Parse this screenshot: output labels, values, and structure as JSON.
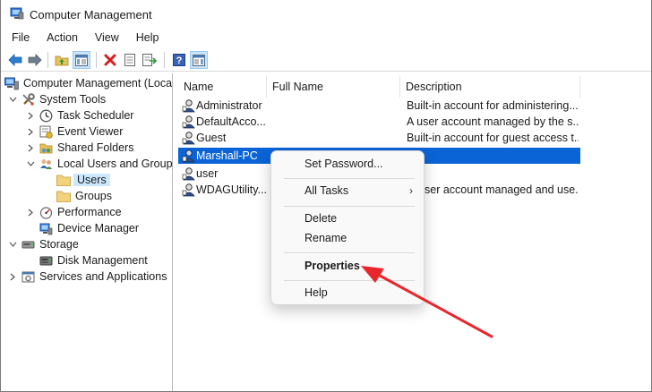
{
  "window": {
    "title": "Computer Management"
  },
  "menubar": {
    "items": [
      "File",
      "Action",
      "View",
      "Help"
    ]
  },
  "toolbar": {
    "buttons": [
      "back-arrow-icon",
      "forward-arrow-icon",
      "up-folder-icon",
      "show-hide-tree-icon",
      "delete-icon",
      "properties-icon",
      "export-list-icon",
      "help-icon",
      "show-hide-action-pane-icon"
    ]
  },
  "tree": {
    "nodes": [
      {
        "label": "Computer Management (Local",
        "icon": "computer-management-icon",
        "level": 0,
        "expander": "none"
      },
      {
        "label": "System Tools",
        "icon": "tools-icon",
        "level": 1,
        "expander": "expanded"
      },
      {
        "label": "Task Scheduler",
        "icon": "clock-icon",
        "level": 2,
        "expander": "collapsed"
      },
      {
        "label": "Event Viewer",
        "icon": "event-viewer-icon",
        "level": 2,
        "expander": "collapsed"
      },
      {
        "label": "Shared Folders",
        "icon": "shared-folder-icon",
        "level": 2,
        "expander": "collapsed"
      },
      {
        "label": "Local Users and Groups",
        "icon": "users-group-icon",
        "level": 2,
        "expander": "expanded"
      },
      {
        "label": "Users",
        "icon": "folder-icon",
        "level": 3,
        "expander": "none",
        "selected": true
      },
      {
        "label": "Groups",
        "icon": "folder-icon",
        "level": 3,
        "expander": "none"
      },
      {
        "label": "Performance",
        "icon": "performance-icon",
        "level": 2,
        "expander": "collapsed"
      },
      {
        "label": "Device Manager",
        "icon": "device-manager-icon",
        "level": 2,
        "expander": "none"
      },
      {
        "label": "Storage",
        "icon": "storage-icon",
        "level": 1,
        "expander": "expanded"
      },
      {
        "label": "Disk Management",
        "icon": "disk-icon",
        "level": 2,
        "expander": "none"
      },
      {
        "label": "Services and Applications",
        "icon": "services-icon",
        "level": 1,
        "expander": "collapsed"
      }
    ]
  },
  "list": {
    "columns": [
      "Name",
      "Full Name",
      "Description"
    ],
    "rows": [
      {
        "name": "Administrator",
        "full_name": "",
        "description": "Built-in account for administering..."
      },
      {
        "name": "DefaultAcco...",
        "full_name": "",
        "description": "A user account managed by the s..."
      },
      {
        "name": "Guest",
        "full_name": "",
        "description": "Built-in account for guest access t..."
      },
      {
        "name": "Marshall-PC",
        "full_name": "",
        "description": "",
        "highlighted": true
      },
      {
        "name": "user",
        "full_name": "",
        "description": ""
      },
      {
        "name": "WDAGUtility...",
        "full_name": "",
        "description": "ser account managed and use..."
      }
    ]
  },
  "context_menu": {
    "items": [
      {
        "label": "Set Password...",
        "bold": false,
        "submenu": false
      },
      {
        "label": "All Tasks",
        "bold": false,
        "submenu": true
      },
      {
        "label": "Delete",
        "bold": false,
        "submenu": false
      },
      {
        "label": "Rename",
        "bold": false,
        "submenu": false
      },
      {
        "label": "Properties",
        "bold": true,
        "submenu": false
      },
      {
        "label": "Help",
        "bold": false,
        "submenu": false
      }
    ],
    "submenu_arrow": "›"
  },
  "colors": {
    "selection": "#0a64d6",
    "tree_selection": "#cce8ff",
    "annotation_arrow": "#e8262d"
  }
}
